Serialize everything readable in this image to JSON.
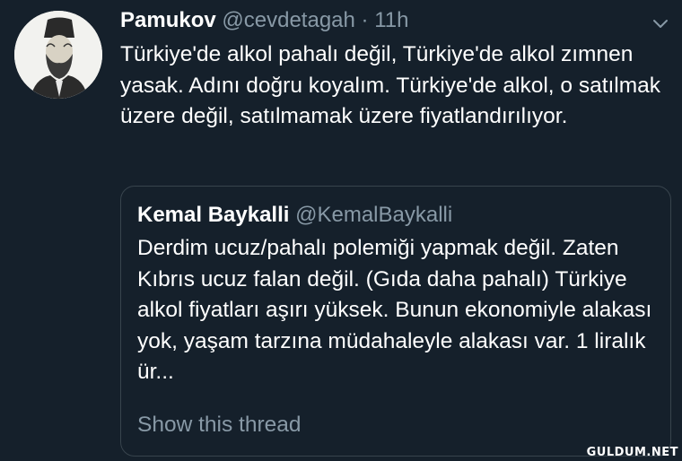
{
  "tweet": {
    "author_name": "Pamukov",
    "author_handle": "@cevdetagah",
    "separator": "·",
    "time": "11h",
    "text": "Türkiye'de alkol pahalı değil, Türkiye'de alkol zımnen yasak. Adını doğru koyalım. Türkiye'de alkol, o satılmak üzere değil, satılmamak üzere fiyatlandırılıyor.",
    "menu_icon": "chevron-down-icon"
  },
  "quoted_tweet": {
    "author_name": "Kemal Baykalli",
    "author_handle": "@KemalBaykalli",
    "text": "Derdim ucuz/pahalı polemiği yapmak değil. Zaten Kıbrıs ucuz falan değil. (Gıda daha pahalı) Türkiye alkol fiyatları aşırı yüksek. Bunun ekonomiyle alakası yok, yaşam tarzına müdahaleyle alakası var. 1 liralık ür...",
    "show_thread_label": "Show this thread"
  },
  "watermark": "GULDUM.NET",
  "colors": {
    "background": "#15202b",
    "secondary_text": "#8899a6",
    "border": "#38444d"
  }
}
